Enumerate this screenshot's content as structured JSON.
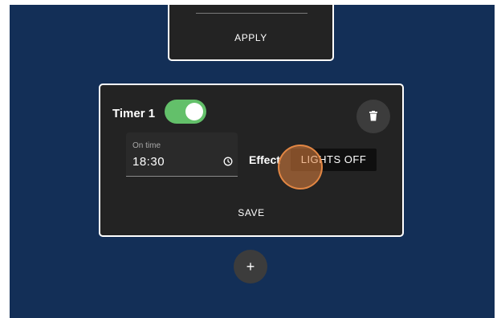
{
  "previous_card": {
    "apply_label": "APPLY"
  },
  "timer_card": {
    "title": "Timer 1",
    "enabled": true,
    "on_time": {
      "label": "On time",
      "value": "18:30"
    },
    "effect": {
      "label": "Effect",
      "value": "LIGHTS OFF"
    },
    "save_label": "SAVE"
  },
  "add_button": {
    "label": "+"
  },
  "colors": {
    "background": "#132f57",
    "card": "#232323",
    "toggle_on": "#63c06a",
    "ripple": "#e28440"
  },
  "icons": {
    "delete": "trash-icon",
    "time": "clock-icon",
    "add": "plus-icon"
  }
}
